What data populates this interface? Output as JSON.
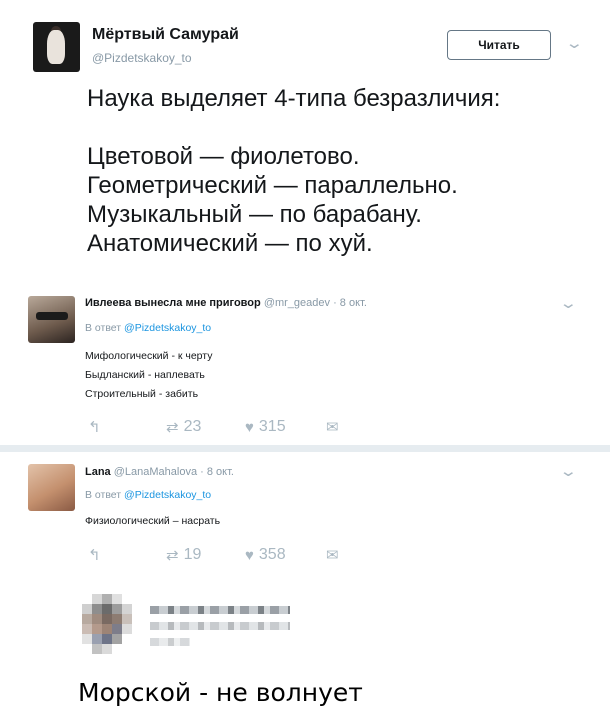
{
  "main_tweet": {
    "author_name": "Мёртвый Самурай",
    "author_handle": "@Pizdetskakoy_to",
    "follow_label": "Читать",
    "text_lines": [
      "Наука выделяет 4-типа безразличия:",
      "",
      "Цветовой — фиолетово.",
      "Геометрический — параллельно.",
      "Музыкальный — по барабану.",
      "Анатомический — по хуй."
    ]
  },
  "replies": [
    {
      "author_name": "Ивлеева вынесла мне приговор",
      "meta": "@mr_geadev · 8 окт.",
      "reply_prefix": "В ответ ",
      "reply_to": "@Pizdetskakoy_to",
      "lines": [
        "Мифологический - к черту",
        "Быдланский - наплевать",
        "Строительный - забить"
      ],
      "retweets": "23",
      "likes": "315"
    },
    {
      "author_name": "Lana",
      "meta": "@LanaMahalova · 8 окт.",
      "reply_prefix": "В ответ ",
      "reply_to": "@Pizdetskakoy_to",
      "lines": [
        "Физиологический – насрать"
      ],
      "retweets": "19",
      "likes": "358"
    }
  ],
  "caption": "Морской - не волнует",
  "icons": {
    "chevron": "chevron-down-icon",
    "reply": "reply-icon",
    "retweet": "retweet-icon",
    "like": "heart-icon",
    "message": "envelope-icon"
  },
  "colors": {
    "link": "#1b95e0",
    "muted": "#8899a6",
    "icon": "#aab8c2",
    "divider": "#e6ecf0"
  }
}
